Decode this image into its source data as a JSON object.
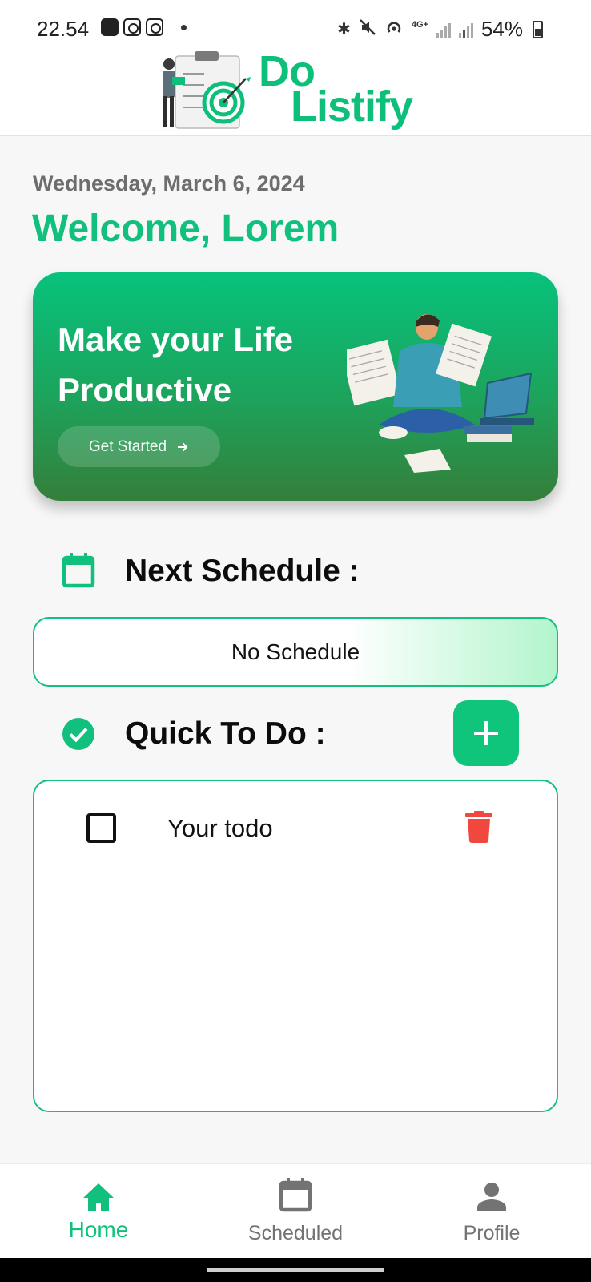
{
  "status_bar": {
    "time": "22.54",
    "battery": "54%",
    "network": "4G+"
  },
  "app": {
    "logo_line1": "Do",
    "logo_line2": "Listify"
  },
  "greeting": {
    "date": "Wednesday, March 6, 2024",
    "welcome": "Welcome, Lorem"
  },
  "banner": {
    "title": "Make your Life Productive",
    "cta_label": "Get Started",
    "cta_icon": "arrow-right-icon"
  },
  "next_schedule": {
    "title": "Next Schedule :",
    "icon": "calendar-icon",
    "empty_text": "No Schedule"
  },
  "quick_todo": {
    "title": "Quick To Do :",
    "icon": "check-circle-icon",
    "add_icon": "plus-icon",
    "items": [
      {
        "text": "Your todo",
        "checked": false,
        "delete_icon": "trash-icon"
      }
    ]
  },
  "bottom_nav": {
    "items": [
      {
        "label": "Home",
        "icon": "home-icon",
        "active": true
      },
      {
        "label": "Scheduled",
        "icon": "calendar-icon",
        "active": false
      },
      {
        "label": "Profile",
        "icon": "person-icon",
        "active": false
      }
    ]
  },
  "colors": {
    "accent": "#10c07c",
    "delete": "#f0483e",
    "banner_top": "#07c27c",
    "banner_bottom": "#347f3a"
  }
}
